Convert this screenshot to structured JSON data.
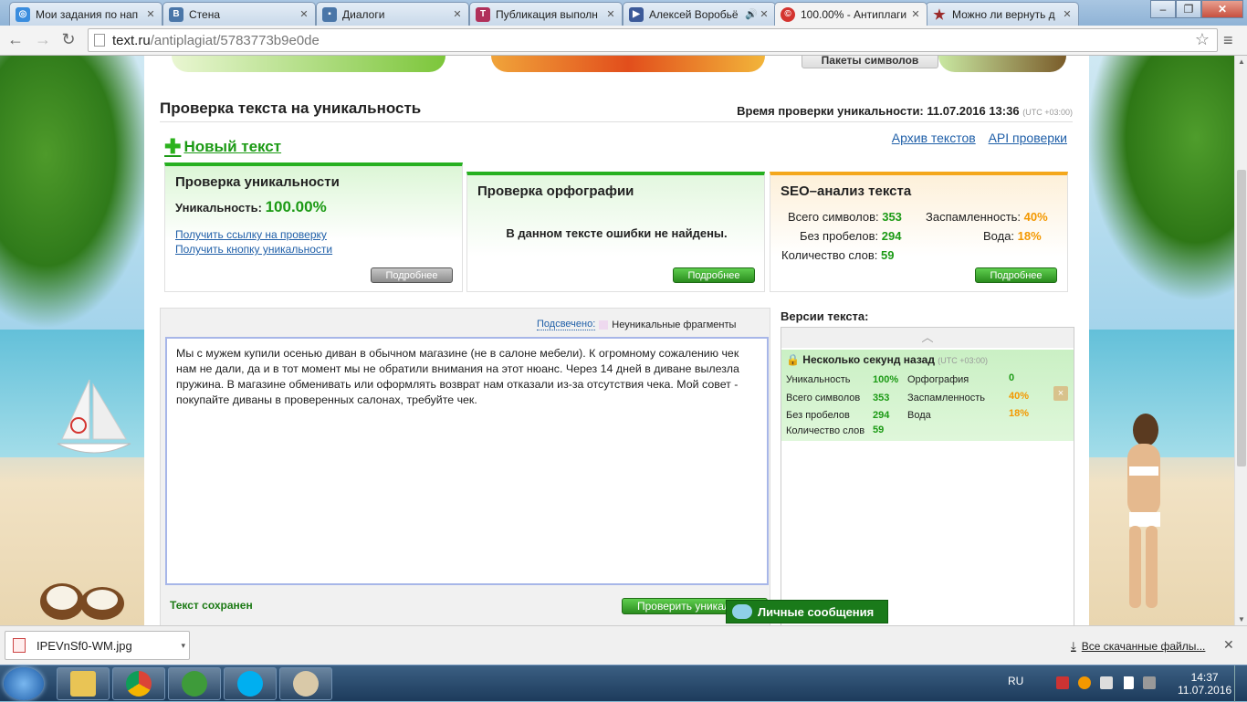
{
  "browser": {
    "tabs": [
      {
        "label": "Мои задания по нап",
        "favicon": "#3a8dde"
      },
      {
        "label": "Стена",
        "favicon": "#4a76a8"
      },
      {
        "label": "Диалоги",
        "favicon": "#4a76a8"
      },
      {
        "label": "Публикация выполн",
        "favicon": "#b0305a"
      },
      {
        "label": "Алексей Воробьё",
        "favicon": "#3c5a99"
      },
      {
        "label": "100.00% - Антиплаги",
        "favicon": "#d4342f"
      },
      {
        "label": "Можно ли вернуть д",
        "favicon": "#9a2a2a"
      }
    ],
    "url_host": "text.ru",
    "url_path": "/antiplagiat/5783773b9e0de",
    "window_buttons": [
      "–",
      "❐",
      "✕"
    ]
  },
  "page": {
    "packages_button": "Пакеты символов",
    "title": "Проверка текста на уникальность",
    "check_time_label": "Время проверки уникальности: 11.07.2016 13:36",
    "check_time_tz": "(UTC +03:00)",
    "new_text": "Новый текст",
    "links": {
      "archive": "Архив текстов",
      "api": "API проверки"
    },
    "uniqueness_card": {
      "title": "Проверка уникальности",
      "label": "Уникальность:",
      "value": "100.00%",
      "link1": "Получить ссылку на проверку",
      "link2": "Получить кнопку уникальности",
      "more": "Подробнее"
    },
    "spelling_card": {
      "title": "Проверка орфографии",
      "message": "В данном тексте ошибки не найдены.",
      "more": "Подробнее"
    },
    "seo_card": {
      "title": "SEO–анализ текста",
      "total_chars_label": "Всего символов:",
      "total_chars": "353",
      "no_spaces_label": "Без пробелов:",
      "no_spaces": "294",
      "words_label": "Количество слов:",
      "words": "59",
      "spam_label": "Заспамленность:",
      "spam": "40%",
      "water_label": "Вода:",
      "water": "18%",
      "more": "Подробнее"
    },
    "editor": {
      "highlight_link": "Подсвечено:",
      "highlight_legend": "Неуникальные фрагменты",
      "text": "Мы с мужем купили осенью диван в обычном магазине (не в салоне мебели). К огромному сожалению чек нам не дали, да и в тот момент мы не обратили внимания на этот нюанс. Через 14 дней в диване вылезла пружина. В магазине обменивать или оформлять возврат нам отказали из-за отсутствия чека. Мой совет - покупайте диваны в проверенных салонах, требуйте чек.",
      "saved": "Текст сохранен",
      "check_button": "Проверить уникальность"
    },
    "versions": {
      "title": "Версии текста:",
      "item_time": "Несколько секунд назад",
      "item_tz": "(UTC +03:00)",
      "uniq_label": "Уникальность",
      "uniq": "100%",
      "spell_label": "Орфография",
      "spell": "0",
      "total_label": "Всего символов",
      "total": "353",
      "spam_label": "Заспамленность",
      "spam": "40%",
      "nosp_label": "Без пробелов",
      "nosp": "294",
      "water_label": "Вода",
      "water": "18%",
      "words_label": "Количество слов",
      "words": "59",
      "delete": "×"
    },
    "personal_messages": "Личные сообщения"
  },
  "downloads": {
    "file": "IPEVnSf0-WM.jpg",
    "all": "Все скачанные файлы..."
  },
  "taskbar": {
    "lang": "RU",
    "time": "14:37",
    "date": "11.07.2016"
  },
  "colors": {
    "accent_green": "#1c9a15",
    "accent_orange": "#f39800",
    "link_blue": "#1f5fa8"
  }
}
